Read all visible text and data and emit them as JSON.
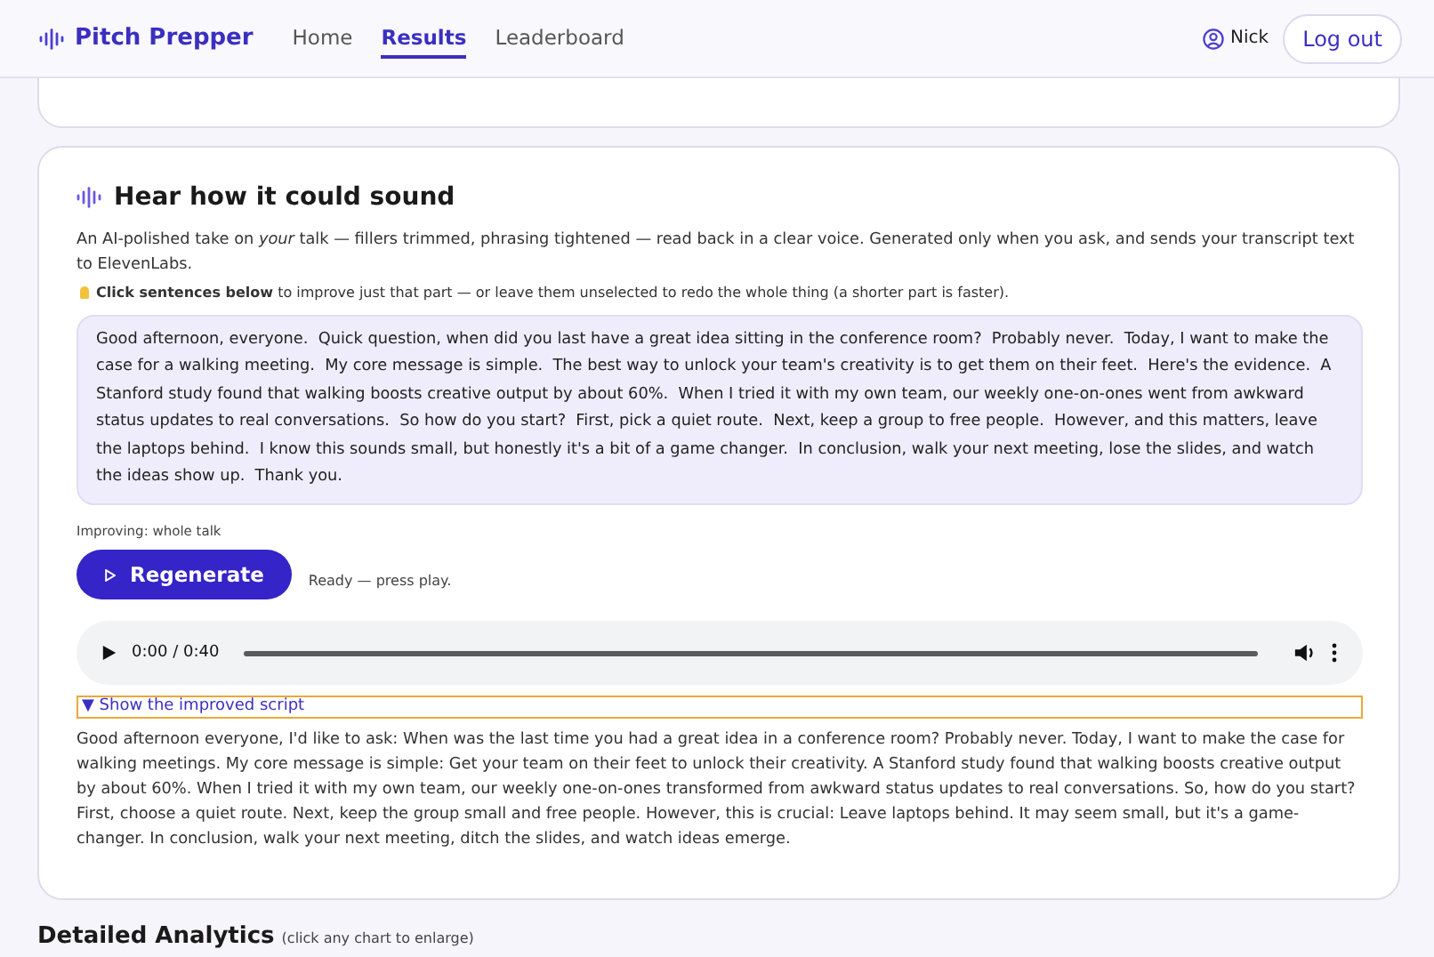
{
  "header": {
    "brand": "Pitch Prepper",
    "nav": [
      {
        "label": "Home",
        "selected": false
      },
      {
        "label": "Results",
        "selected": true
      },
      {
        "label": "Leaderboard",
        "selected": false
      }
    ],
    "user": "Nick",
    "logout": "Log out"
  },
  "card": {
    "title": "Hear how it could sound",
    "intro": "An AI-polished take on *your* talk — fillers trimmed, phrasing tightened — read back in a clear voice. Generated only when you ask, and sends your transcript text to ElevenLabs.",
    "tip": "**Click sentences below** to improve just that part — or leave them unselected to redo the whole thing (a shorter part is faster).",
    "transcript": "Good afternoon, everyone.  Quick question, when did you last have a great idea sitting in the conference room?  Probably never.  Today, I want to make the case for a walking meeting.  My core message is simple.  The best way to unlock your team's creativity is to get them on their feet.  Here's the evidence.  A Stanford study found that walking boosts creative output by about 60%.  When I tried it with my own team, our weekly one-on-ones went from awkward status updates to real conversations.  So how do you start?  First, pick a quiet route.  Next, keep a group to free people.  However, and this matters, leave the laptops behind.  I know this sounds small, but honestly it's a bit of a game changer.  In conclusion, walk your next meeting, lose the slides, and watch the ideas show up.  Thank you.",
    "improving": "Improving: whole talk",
    "button": "Regenerate",
    "status": "Ready — press play.",
    "player": {
      "time": "0:00 / 0:40"
    },
    "details": {
      "summary": "▼ Show the improved script",
      "expanded": true,
      "script": "Good afternoon everyone, I'd like to ask: When was the last time you had a great idea in a conference room? Probably never. Today, I want to make the case for walking meetings. My core message is simple: Get your team on their feet to unlock their creativity. A Stanford study found that walking boosts creative output by about 60%. When I tried it with my own team, our weekly one-on-ones transformed from awkward status updates to real conversations. So, how do you start? First, choose a quiet route. Next, keep the group small and free people. However, this is crucial: Leave laptops behind. It may seem small, but it's a game-changer. In conclusion, walk your next meeting, ditch the slides, and watch ideas emerge."
    }
  },
  "analytics": {
    "title": "Detailed Analytics",
    "hint": "(click any chart to enlarge)"
  }
}
